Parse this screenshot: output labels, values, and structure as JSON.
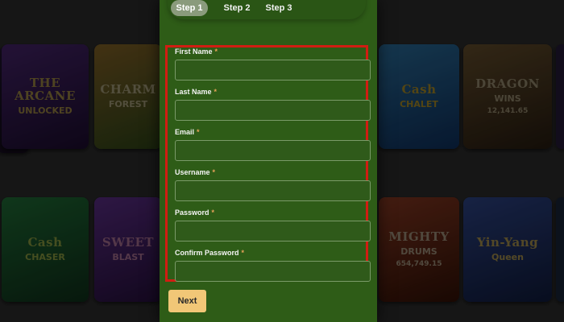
{
  "steps": [
    {
      "label": "Step 1",
      "active": true
    },
    {
      "label": "Step 2",
      "active": false
    },
    {
      "label": "Step 3",
      "active": false
    }
  ],
  "form": {
    "fields": [
      {
        "label": "First Name",
        "required_mark": "*",
        "value": ""
      },
      {
        "label": "Last Name",
        "required_mark": "*",
        "value": ""
      },
      {
        "label": "Email",
        "required_mark": "*",
        "value": ""
      },
      {
        "label": "Username",
        "required_mark": "*",
        "value": ""
      },
      {
        "label": "Password",
        "required_mark": "*",
        "value": ""
      },
      {
        "label": "Confirm Password",
        "required_mark": "*",
        "value": ""
      }
    ],
    "next_label": "Next"
  },
  "background_games": [
    {
      "title": "THE ARCANE",
      "subtitle": "UNLOCKED",
      "color": "#5b2a8c"
    },
    {
      "title": "CHARM",
      "subtitle": "FOREST",
      "color": "#b8862f"
    },
    {
      "title": "Cash",
      "subtitle": "CHALET",
      "color": "#2f8fd6"
    },
    {
      "title": "DRAGON",
      "subtitle": "WINS",
      "color": "#8a6a3a"
    },
    {
      "title": "Cash",
      "subtitle": "CHASER",
      "color": "#2f9a4a"
    },
    {
      "title": "SWEET",
      "subtitle": "BLAST",
      "color": "#7a3ab8"
    },
    {
      "title": "MIGHTY",
      "subtitle": "DRUMS",
      "color": "#b04a2a"
    },
    {
      "title": "Yin-Yang",
      "subtitle": "Queen",
      "color": "#3a5ab0"
    }
  ],
  "background_amounts": [
    "12,141.65",
    "654,749.15"
  ],
  "colors": {
    "modal_bg": "#2e5c17",
    "highlight_border": "#d11d12",
    "next_button": "#f1c777",
    "required_asterisk": "#e8a35a"
  }
}
